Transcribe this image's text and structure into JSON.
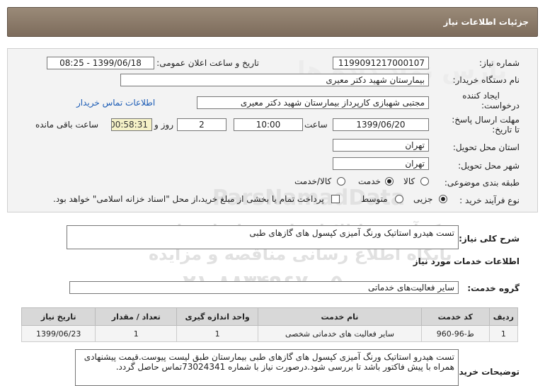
{
  "header": {
    "title": "جزئیات اطلاعات نیاز"
  },
  "form": {
    "need_number_label": "شماره نیاز:",
    "need_number": "1199091217000107",
    "announce_label": "تاریخ و ساعت اعلان عمومی:",
    "announce_value": "1399/06/18 - 08:25",
    "buyer_org_label": "نام دستگاه خریدار:",
    "buyer_org": "بیمارستان شهید دکتر معیری",
    "creator_label_1": "ایجاد کننده",
    "creator_label_2": "درخواست:",
    "creator": "مجتبی  شهبازی کارپرداز بیمارستان شهید دکتر معیری",
    "contact_link": "اطلاعات تماس خریدار",
    "deadline_label_1": "مهلت ارسال پاسخ:",
    "deadline_label_2": "تا تاریخ:",
    "deadline_date": "1399/06/20",
    "time_label": "ساعت",
    "deadline_time": "10:00",
    "days_value": "2",
    "days_label": "روز و",
    "remaining_time": "00:58:31",
    "remaining_label": "ساعت باقی مانده",
    "province_label": "استان محل تحویل:",
    "province": "تهران",
    "city_label": "شهر محل تحویل:",
    "city": "تهران",
    "category_label": "طبقه بندی موضوعی:",
    "category_options": [
      "کالا",
      "خدمت",
      "کالا/خدمت"
    ],
    "category_selected": "خدمت",
    "process_label": "نوع فرآیند خرید :",
    "process_options": [
      "جزیی",
      "متوسط"
    ],
    "process_selected": "جزیی",
    "payment_note": "پرداخت تمام یا بخشی از مبلغ خرید،از محل \"اسناد خزانه اسلامی\" خواهد بود."
  },
  "summary": {
    "label": "شرح کلی نیاز:",
    "value": "تست هیدرو استاتیک ورنگ آمیزی کپسول های گازهای طبی"
  },
  "services": {
    "section_title": "اطلاعات خدمات مورد نیاز",
    "group_label": "گروه خدمت:",
    "group_value": "سایر فعالیت‌های خدماتی",
    "columns": [
      "ردیف",
      "کد خدمت",
      "نام خدمت",
      "واحد اندازه گیری",
      "تعداد / مقدار",
      "تاریخ نیاز"
    ],
    "rows": [
      [
        "1",
        "ط-96-960",
        "سایر فعالیت های خدماتی شخصی",
        "1",
        "1",
        "1399/06/23"
      ]
    ]
  },
  "buyer_notes": {
    "label": "توضیحات خریدار:",
    "value": "تست هیدرو استاتیک ورنگ آمیزی کپسول های گازهای طبی بیمارستان طبق لیست پیوست.قیمت پیشنهادی همراه با پیش فاکتور باشد تا بررسی شود.درصورت نیاز با شماره 73024341تماس حاصل گردد."
  },
  "watermark": {
    "brand": "ParsNamadData",
    "line1": "پارس نماد داده ها",
    "line2": "مرکز آموزش اطلاعات پارس نماد داده ها",
    "line3": "پایگاه اطلاع رسانی مناقصه و مزایده",
    "phone": "۰۲۱-۸۸۳۴۹۶۷۰-۵"
  }
}
